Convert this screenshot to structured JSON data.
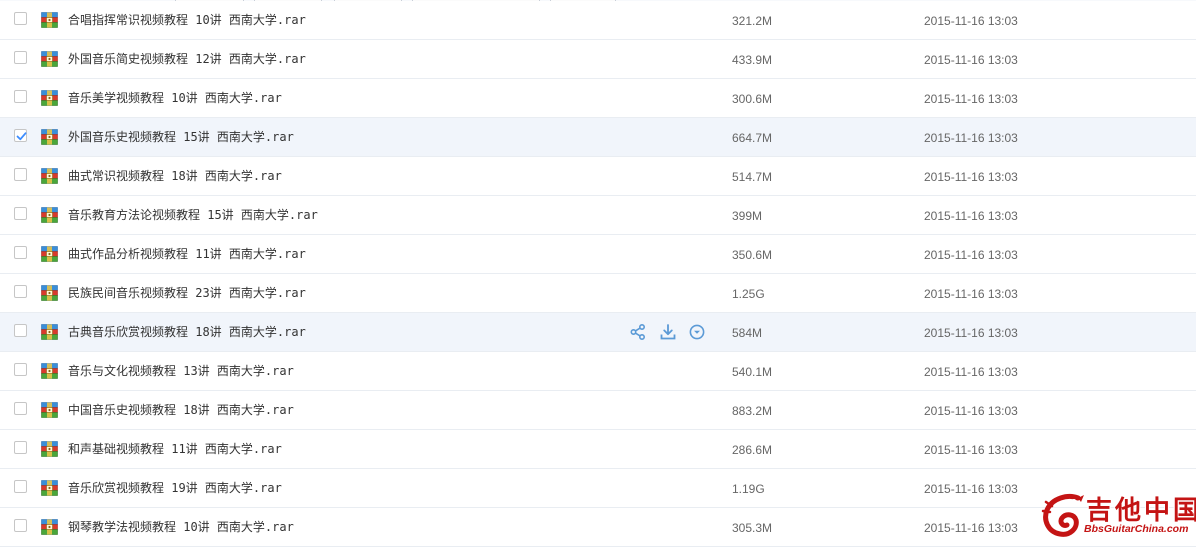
{
  "colors": {
    "row_border": "#e9edf2",
    "selected_row_bg": "#f1f5fb",
    "checkbox_check": "#3b8cff",
    "action_icon": "#5b9ad6",
    "watermark_red": "#c41414"
  },
  "file_icon": "rar-archive-icon",
  "row_actions": {
    "share_icon": "share-icon",
    "download_icon": "download-icon",
    "more_icon": "chevron-down-circle-icon"
  },
  "files": [
    {
      "name": "合唱指挥常识视频教程 10讲 西南大学.rar",
      "size": "321.2M",
      "date": "2015-11-16 13:03",
      "checked": false,
      "hovered": false
    },
    {
      "name": "外国音乐简史视频教程 12讲 西南大学.rar",
      "size": "433.9M",
      "date": "2015-11-16 13:03",
      "checked": false,
      "hovered": false
    },
    {
      "name": "音乐美学视频教程 10讲 西南大学.rar",
      "size": "300.6M",
      "date": "2015-11-16 13:03",
      "checked": false,
      "hovered": false
    },
    {
      "name": "外国音乐史视频教程 15讲 西南大学.rar",
      "size": "664.7M",
      "date": "2015-11-16 13:03",
      "checked": true,
      "hovered": false
    },
    {
      "name": "曲式常识视频教程 18讲 西南大学.rar",
      "size": "514.7M",
      "date": "2015-11-16 13:03",
      "checked": false,
      "hovered": false
    },
    {
      "name": "音乐教育方法论视频教程 15讲 西南大学.rar",
      "size": "399M",
      "date": "2015-11-16 13:03",
      "checked": false,
      "hovered": false
    },
    {
      "name": "曲式作品分析视频教程 11讲 西南大学.rar",
      "size": "350.6M",
      "date": "2015-11-16 13:03",
      "checked": false,
      "hovered": false
    },
    {
      "name": "民族民间音乐视频教程 23讲 西南大学.rar",
      "size": "1.25G",
      "date": "2015-11-16 13:03",
      "checked": false,
      "hovered": false
    },
    {
      "name": "古典音乐欣赏视频教程 18讲 西南大学.rar",
      "size": "584M",
      "date": "2015-11-16 13:03",
      "checked": false,
      "hovered": true
    },
    {
      "name": "音乐与文化视频教程 13讲 西南大学.rar",
      "size": "540.1M",
      "date": "2015-11-16 13:03",
      "checked": false,
      "hovered": false
    },
    {
      "name": "中国音乐史视频教程 18讲 西南大学.rar",
      "size": "883.2M",
      "date": "2015-11-16 13:03",
      "checked": false,
      "hovered": false
    },
    {
      "name": "和声基础视频教程 11讲 西南大学.rar",
      "size": "286.6M",
      "date": "2015-11-16 13:03",
      "checked": false,
      "hovered": false
    },
    {
      "name": "音乐欣赏视频教程 19讲 西南大学.rar",
      "size": "1.19G",
      "date": "2015-11-16 13:03",
      "checked": false,
      "hovered": false
    },
    {
      "name": "钢琴教学法视频教程 10讲 西南大学.rar",
      "size": "305.3M",
      "date": "2015-11-16 13:03",
      "checked": false,
      "hovered": false
    }
  ],
  "watermark": {
    "title": "吉他中国",
    "subtitle": "BbsGuitarChina.com"
  }
}
